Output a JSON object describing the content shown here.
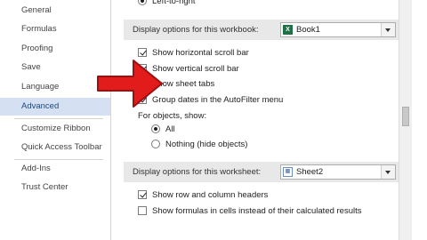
{
  "sidebar": {
    "items": [
      {
        "label": "General"
      },
      {
        "label": "Formulas"
      },
      {
        "label": "Proofing"
      },
      {
        "label": "Save"
      },
      {
        "label": "Language"
      },
      {
        "label": "Advanced"
      },
      {
        "label": "Customize Ribbon"
      },
      {
        "label": "Quick Access Toolbar"
      },
      {
        "label": "Add-Ins"
      },
      {
        "label": "Trust Center"
      }
    ]
  },
  "main": {
    "top_cut_option": "Left-to-right",
    "workbook_section": {
      "label": "Display options for this workbook:",
      "selected": "Book1",
      "options": [
        {
          "label": "Show horizontal scroll bar",
          "checked": true
        },
        {
          "label": "Show vertical scroll bar",
          "checked": true
        },
        {
          "label": "Show sheet tabs",
          "checked": true
        },
        {
          "label": "Group dates in the AutoFilter menu",
          "checked": true
        }
      ],
      "objects_label": "For objects, show:",
      "objects_options": [
        {
          "label": "All",
          "selected": true
        },
        {
          "label": "Nothing (hide objects)",
          "selected": false
        }
      ]
    },
    "worksheet_section": {
      "label": "Display options for this worksheet:",
      "selected": "Sheet2",
      "options": [
        {
          "label": "Show row and column headers",
          "checked": true
        },
        {
          "label": "Show formulas in cells instead of their calculated results",
          "checked": false
        }
      ]
    }
  },
  "colors": {
    "active_nav_bg": "#d5e1f2",
    "arrow": "#e21b1b",
    "section_header_bg": "#e8e8e8"
  }
}
